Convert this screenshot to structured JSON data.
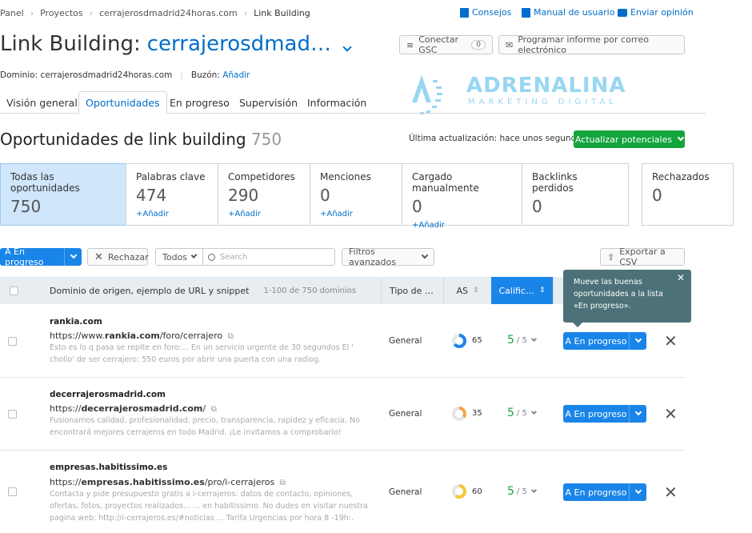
{
  "breadcrumb": [
    "Panel",
    "Proyectos",
    "cerrajerosdmadrid24horas.com",
    "Link Building"
  ],
  "top_links": {
    "tips": "Consejos",
    "manual": "Manual de usuario",
    "feedback": "Enviar opinión"
  },
  "header": {
    "title_prefix": "Link Building:",
    "title_domain": "cerrajerosdmad…",
    "gsc_button": "Conectar GSC",
    "gsc_count": "0",
    "schedule_button": "Programar informe por correo electrónico",
    "domain_line": "Dominio: cerrajerosdmadrid24horas.com",
    "mailbox_label": "Buzón:",
    "mailbox_link": "Añadir"
  },
  "watermark": {
    "brand": "ADRENALINA",
    "tagline": "MARKETING DIGITAL"
  },
  "tabs": [
    "Visión general",
    "Oportunidades",
    "En progreso",
    "Supervisión",
    "Información"
  ],
  "section": {
    "title": "Oportunidades de link building",
    "count": "750",
    "last_update": "Última actualización: hace unos segundos",
    "update_button": "Actualizar potenciales"
  },
  "cards": [
    {
      "label": "Todas las oportunidades",
      "value": "750",
      "add": ""
    },
    {
      "label": "Palabras clave",
      "value": "474",
      "add": "+Añadir"
    },
    {
      "label": "Competidores",
      "value": "290",
      "add": "+Añadir"
    },
    {
      "label": "Menciones",
      "value": "0",
      "add": "+Añadir"
    },
    {
      "label": "Cargado manualmente",
      "value": "0",
      "add": "+Añadir"
    },
    {
      "label": "Backlinks perdidos",
      "value": "0",
      "add": ""
    },
    {
      "label": "Rechazados",
      "value": "0",
      "add": ""
    }
  ],
  "toolbar": {
    "progress_button": "A En progreso",
    "reject_button": "Rechazar",
    "filter_select": "Todos",
    "search_placeholder": "Search",
    "advanced_filters": "Filtros avanzados",
    "export": "Exportar a CSV"
  },
  "table": {
    "col_source": "Dominio de origen, ejemplo de URL y snippet",
    "range": "1-100 de 750 dominios",
    "col_type": "Tipo de …",
    "col_as": "AS",
    "col_rating": "Calific…"
  },
  "tooltip": "Mueve las buenas oportunidades a la lista «En progreso».",
  "rows": [
    {
      "domain": "rankia.com",
      "url_pre": "https://www.",
      "url_bold": "rankia.com",
      "url_post": "/foro/cerrajero",
      "snippet": "Esto es lo q pasa se repite en foro:... En un servicio urgente de 30 segundos El ' chollo' de ser cerrajero: 550 euros por abrir una puerta con una radiog.",
      "type": "General",
      "as": "65",
      "rating": "5",
      "rating_max": "/ 5",
      "action": "A En progreso"
    },
    {
      "domain": "decerrajerosmadrid.com",
      "url_pre": "https://",
      "url_bold": "decerrajerosmadrid.com",
      "url_post": "/",
      "snippet": "Fusionamos calidad, profesionalidad, precio, transparencia, rapidez y eficacia. No encontrará mejores cerrajeros en todo Madrid. ¡Le invitamos a comprobarlo!",
      "type": "General",
      "as": "35",
      "rating": "5",
      "rating_max": "/ 5",
      "action": "A En progreso"
    },
    {
      "domain": "empresas.habitissimo.es",
      "url_pre": "https://",
      "url_bold": "empresas.habitissimo.es",
      "url_post": "/pro/i-cerrajeros",
      "snippet": "Contacta y pide presupuesto gratis a i-cerrajeros: datos de contacto, opiniones, ofertas, fotos, proyectos realizados... ... en habitissimo. No dudes en visitar nuestra pagina web: http://i-cerrajeros.es/#noticias ... Tarifa Urgencias por hora 8 -19h:.",
      "type": "General",
      "as": "60",
      "rating": "5",
      "rating_max": "/ 5",
      "action": "A En progreso"
    }
  ],
  "colors": {
    "accent": "#006dca",
    "button_blue": "#1a85e8",
    "green": "#13a43c",
    "tooltip_bg": "#4d7178"
  }
}
